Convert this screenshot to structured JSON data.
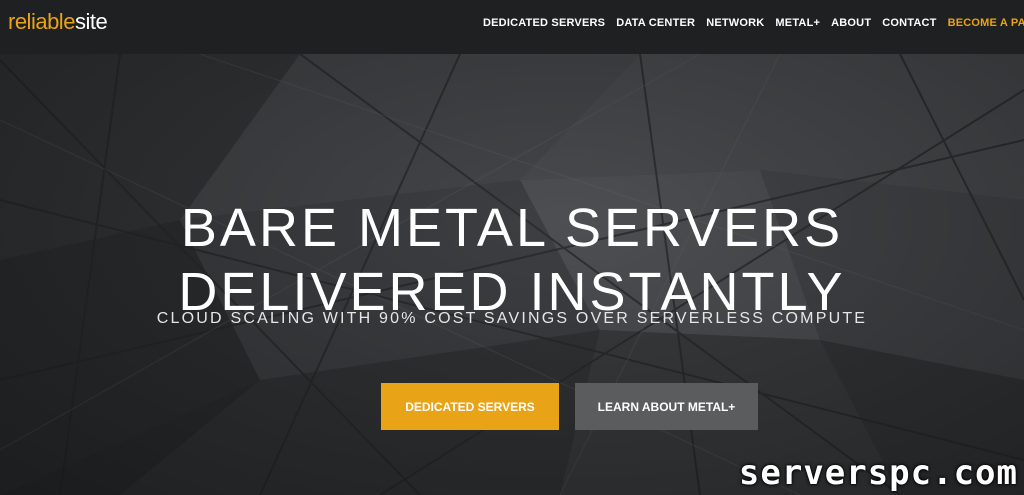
{
  "brand": {
    "logo_part1": "reliable",
    "logo_part2": "site",
    "accent_color": "#e8a317"
  },
  "nav": {
    "items": [
      {
        "label": "DEDICATED SERVERS"
      },
      {
        "label": "DATA CENTER"
      },
      {
        "label": "NETWORK"
      },
      {
        "label": "METAL+"
      },
      {
        "label": "ABOUT"
      },
      {
        "label": "CONTACT"
      },
      {
        "label": "BECOME A PARTNE"
      }
    ]
  },
  "hero": {
    "title_line1": "BARE METAL SERVERS",
    "title_line2": "DELIVERED INSTANTLY",
    "subtitle": "CLOUD SCALING WITH 90% COST SAVINGS OVER SERVERLESS COMPUTE",
    "primary_button": "DEDICATED SERVERS",
    "secondary_button": "LEARN ABOUT METAL+"
  },
  "watermark": "serverspc.com"
}
